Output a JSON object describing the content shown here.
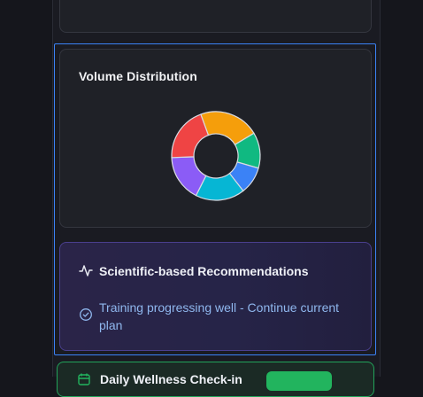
{
  "volume_card": {
    "title": "Volume Distribution",
    "segments": [
      {
        "color": "#f59e0b",
        "value": 0.22
      },
      {
        "color": "#10b981",
        "value": 0.13
      },
      {
        "color": "#3b82f6",
        "value": 0.1
      },
      {
        "color": "#06b6d4",
        "value": 0.18
      },
      {
        "color": "#8b5cf6",
        "value": 0.17
      },
      {
        "color": "#ef4444",
        "value": 0.2
      }
    ]
  },
  "recommendations": {
    "title": "Scientific-based Recommendations",
    "items": [
      {
        "text": "Training progressing well - Continue current plan"
      }
    ]
  },
  "wellness": {
    "title": "Daily Wellness Check-in"
  },
  "colors": {
    "selection_outline": "#3b82f6",
    "recommendation_text": "#8fb7ee",
    "wellness_accent": "#22b45e"
  },
  "icons": {
    "recommendations": "activity-icon",
    "item": "check-circle-icon",
    "wellness": "calendar-icon"
  }
}
